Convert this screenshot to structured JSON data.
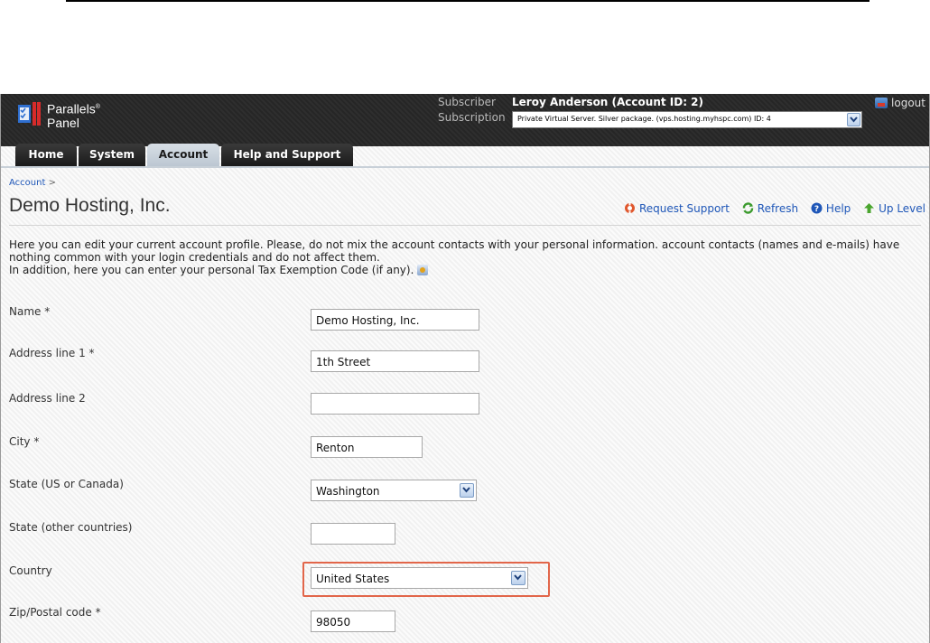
{
  "header": {
    "logo_line1": "Parallels",
    "logo_reg": "®",
    "logo_line2": "Panel",
    "subscriber_label": "Subscriber",
    "subscriber_name": "Leroy Anderson (Account ID: 2)",
    "subscription_label": "Subscription",
    "subscription_value": "Private Virtual Server. Silver package. (vps.hosting.myhspc.com) ID: 4",
    "logout_label": "logout"
  },
  "tabs": [
    {
      "label": "Home"
    },
    {
      "label": "System"
    },
    {
      "label": "Account"
    },
    {
      "label": "Help and Support"
    }
  ],
  "breadcrumb": {
    "item": "Account",
    "separator": ">"
  },
  "page_title": "Demo Hosting, Inc.",
  "actions": {
    "request_support": "Request Support",
    "refresh": "Refresh",
    "help": "Help",
    "up_level": "Up Level"
  },
  "description": {
    "line1": "Here you can edit your current account profile. Please, do not mix the account contacts with your personal information. account contacts (names and e-mails) have",
    "line2": "nothing common with your login credentials and do not affect them.",
    "line3": "In addition, here you can enter your personal Tax Exemption Code (if any)."
  },
  "form": {
    "name_label": "Name *",
    "name_value": "Demo Hosting, Inc.",
    "address1_label": "Address line 1 *",
    "address1_value": "1th Street",
    "address2_label": "Address line 2",
    "address2_value": "",
    "city_label": "City *",
    "city_value": "Renton",
    "state_us_label": "State (US or Canada)",
    "state_us_value": "Washington",
    "state_other_label": "State (other countries)",
    "state_other_value": "",
    "country_label": "Country",
    "country_value": "United States",
    "zip_label": "Zip/Postal code *",
    "zip_value": "98050"
  },
  "colors": {
    "accent_link": "#1f57b8",
    "highlight_border": "#e2664a",
    "header_bg": "#2b2b2b"
  }
}
